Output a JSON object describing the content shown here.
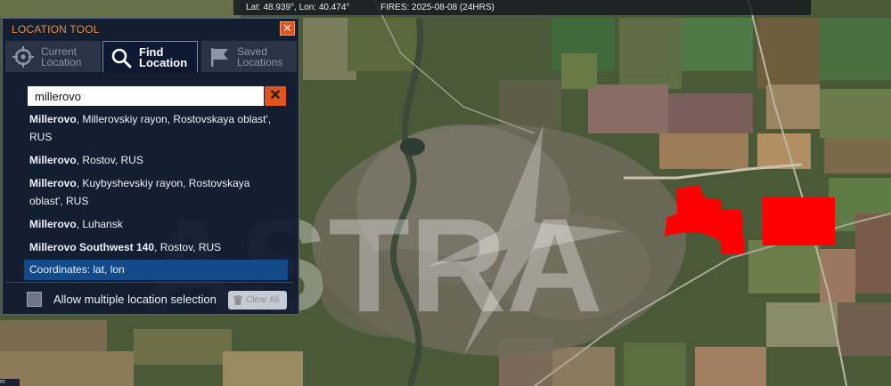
{
  "topbar": {
    "coords": "Lat: 48.939°, Lon: 40.474°",
    "fires": "FIRES: 2025-08-08 (24HRS)"
  },
  "panel": {
    "title": "LOCATION TOOL",
    "close_label": "✕",
    "tabs": [
      {
        "line1": "Current",
        "line2": "Location",
        "icon": "crosshair-icon",
        "active": false
      },
      {
        "line1": "Find",
        "line2": "Location",
        "icon": "magnifier-icon",
        "active": true
      },
      {
        "line1": "Saved",
        "line2": "Locations",
        "icon": "flag-icon",
        "active": false
      }
    ],
    "search": {
      "value": "millerovo",
      "clear_label": "✕"
    },
    "results": [
      {
        "name": "Millerovo",
        "detail": ", Millerovskiy rayon, Rostovskaya oblast', RUS"
      },
      {
        "name": "Millerovo",
        "detail": ", Rostov, RUS"
      },
      {
        "name": "Millerovo",
        "detail": ", Kuybyshevskiy rayon, Rostovskaya oblast', RUS"
      },
      {
        "name": "Millerovo",
        "detail": ", Luhansk"
      },
      {
        "name": "Millerovo Southwest 140",
        "detail": ", Rostov, RUS"
      }
    ],
    "coordinates_option": "Coordinates: lat, lon",
    "multi_select_label": "Allow multiple location selection",
    "clear_all_label": "Clear All"
  },
  "watermark": {
    "text": "ASTRA"
  },
  "scale": {
    "label": "m"
  },
  "colors": {
    "panel_bg": "#101a30",
    "accent_orange": "#e0531c",
    "title_orange": "#f08a3e",
    "highlight_blue": "#124a8a",
    "fire_red": "#ff0000"
  }
}
